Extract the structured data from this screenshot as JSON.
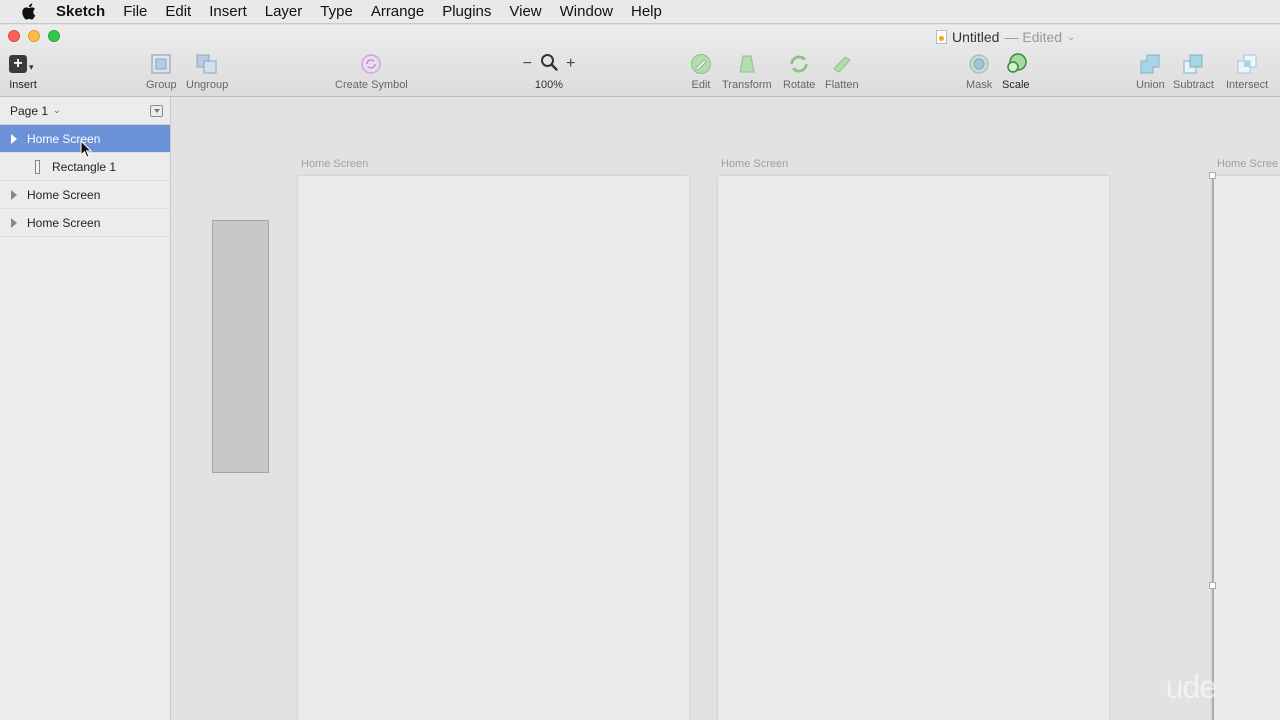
{
  "menubar": {
    "app": "Sketch",
    "items": [
      "File",
      "Edit",
      "Insert",
      "Layer",
      "Type",
      "Arrange",
      "Plugins",
      "View",
      "Window",
      "Help"
    ]
  },
  "window": {
    "title": "Untitled",
    "status": "— Edited",
    "title_chevron": "⌄"
  },
  "toolbar": {
    "insert": "Insert",
    "group": "Group",
    "ungroup": "Ungroup",
    "create_symbol": "Create Symbol",
    "zoom_level": "100%",
    "zoom_out": "−",
    "zoom_in": "+",
    "edit": "Edit",
    "transform": "Transform",
    "rotate": "Rotate",
    "flatten": "Flatten",
    "mask": "Mask",
    "scale": "Scale",
    "union": "Union",
    "subtract": "Subtract",
    "intersect": "Intersect"
  },
  "sidebar": {
    "page": "Page 1",
    "page_chevron": "⌄",
    "layers": [
      {
        "name": "Home Screen"
      },
      {
        "name": "Rectangle 1"
      },
      {
        "name": "Home Screen"
      },
      {
        "name": "Home Screen"
      }
    ]
  },
  "canvas": {
    "artboards": [
      {
        "label": "Home Screen"
      },
      {
        "label": "Home Screen"
      },
      {
        "label": "Home Scree"
      }
    ],
    "watermark": "ude"
  },
  "colors": {
    "selection": "#6b91d8",
    "canvas": "#e2e2e2",
    "artboard": "#ebebeb"
  }
}
